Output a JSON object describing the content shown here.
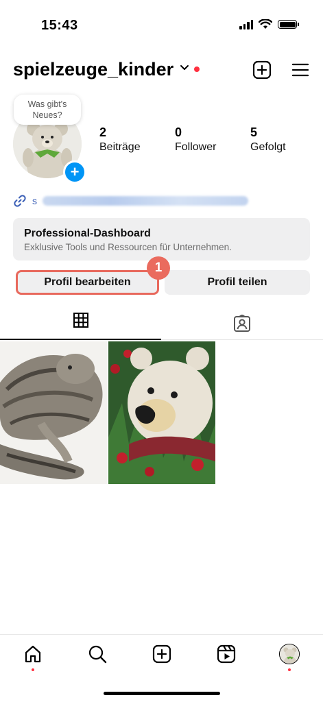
{
  "status": {
    "time": "15:43"
  },
  "profile": {
    "username": "spielzeuge_kinder",
    "note": "Was gibt's Neues?",
    "stats": [
      {
        "value": "2",
        "label": "Beiträge"
      },
      {
        "value": "0",
        "label": "Follower"
      },
      {
        "value": "5",
        "label": "Gefolgt"
      }
    ],
    "link_prefix": "s"
  },
  "dashboard": {
    "title": "Professional-Dashboard",
    "subtitle": "Exklusive Tools und Ressourcen für Unternehmen."
  },
  "buttons": {
    "edit": "Profil bearbeiten",
    "share": "Profil teilen"
  },
  "annotation": {
    "step": "1"
  },
  "colors": {
    "accent_blue": "#0095f6",
    "notification_red": "#ff3040",
    "highlight": "#e8695d"
  },
  "icons": {
    "header": [
      "chevron-down-icon",
      "add-post-icon",
      "menu-icon"
    ],
    "tabs": [
      "grid-icon",
      "tagged-icon"
    ],
    "nav": [
      "home-icon",
      "search-icon",
      "create-icon",
      "reels-icon",
      "profile-avatar"
    ]
  }
}
